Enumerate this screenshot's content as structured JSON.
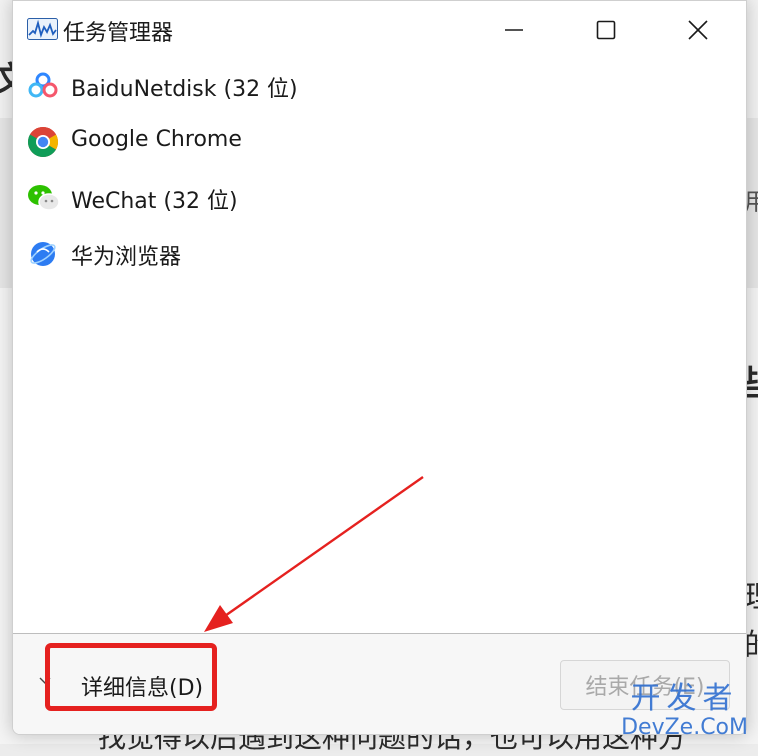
{
  "window": {
    "title": "任务管理器",
    "controls": {
      "minimize_icon": "minimize-icon",
      "maximize_icon": "maximize-icon",
      "close_icon": "close-icon"
    }
  },
  "apps": [
    {
      "name": "BaiduNetdisk (32 位)",
      "icon": "baidunetdisk-icon"
    },
    {
      "name": "Google Chrome",
      "icon": "chrome-icon"
    },
    {
      "name": "WeChat (32 位)",
      "icon": "wechat-icon"
    },
    {
      "name": "华为浏览器",
      "icon": "huawei-browser-icon"
    }
  ],
  "footer": {
    "details_label": "详细信息(D)",
    "end_task_label": "结束任务(E)"
  },
  "annotation": {
    "color": "#e5211f"
  },
  "watermark": {
    "cn": "开发者",
    "en": "DevZe.CoM"
  },
  "background_fragments": {
    "frag1": "文",
    "frag2": "用",
    "frag3": "些",
    "frag4": "理",
    "frag5": "的",
    "frag6": "找觉得以后遇到这种问题的话，也可以用这种方"
  }
}
